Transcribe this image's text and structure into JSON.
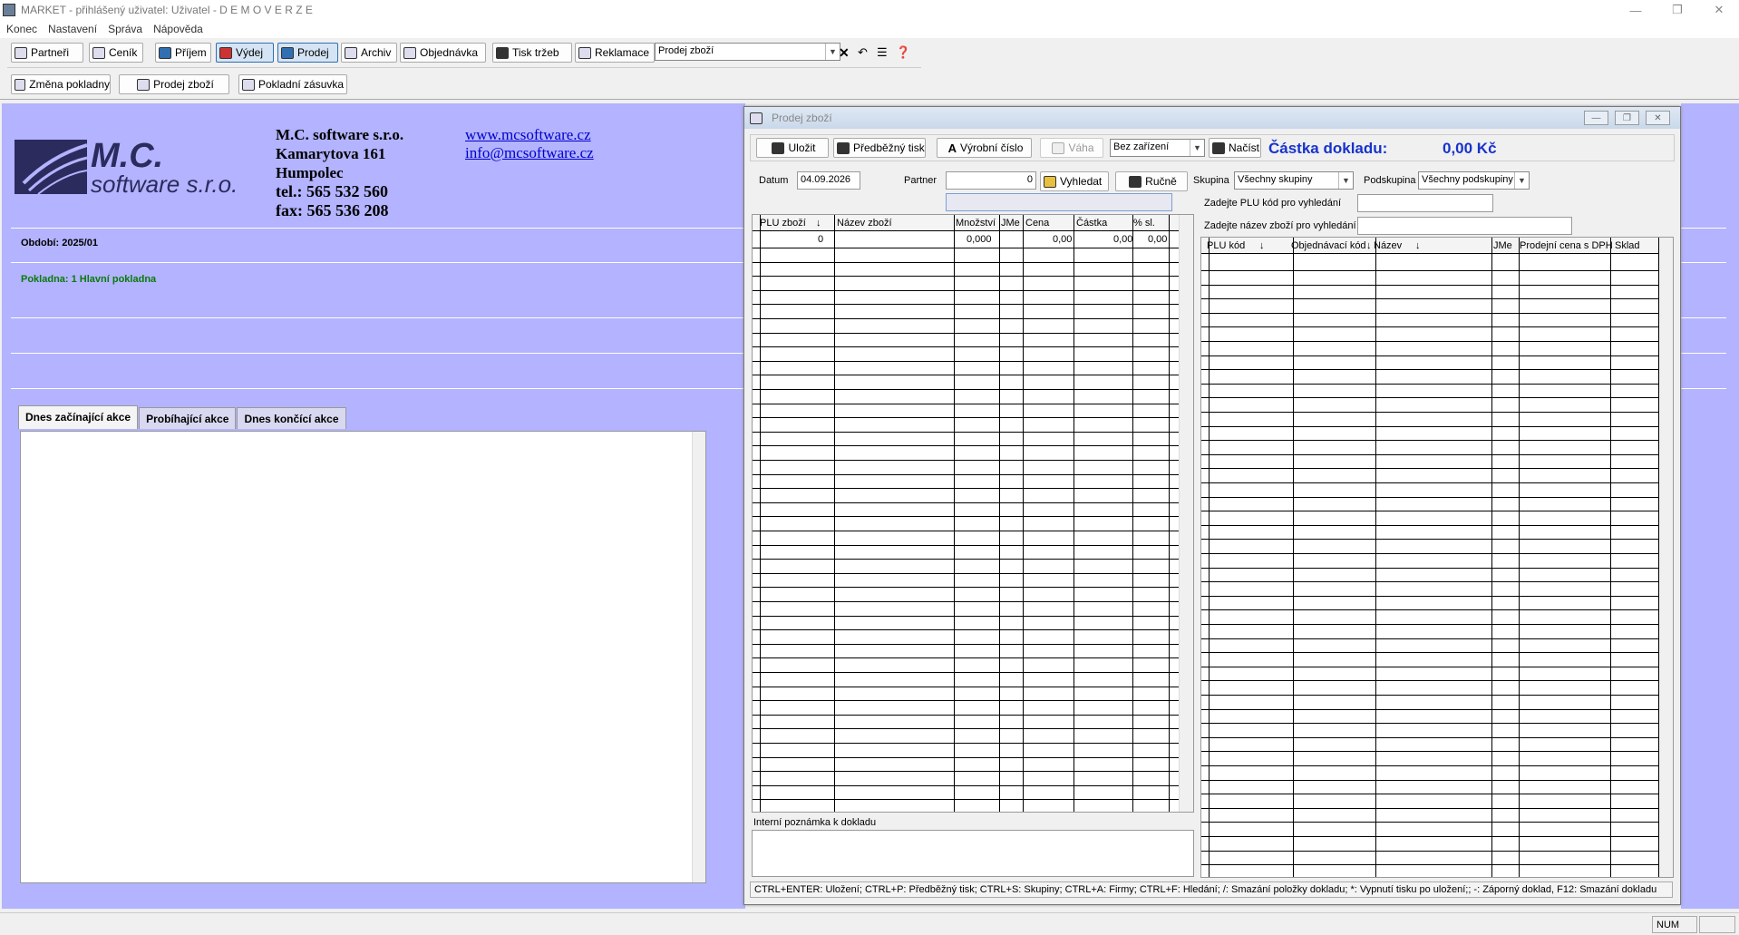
{
  "window": {
    "title": "MARKET - přihlášený uživatel: Uživatel - D E M O V E R Z E"
  },
  "menu": [
    "Konec",
    "Nastavení",
    "Správa",
    "Nápověda"
  ],
  "toolbar": {
    "partneri": "Partneři",
    "cenik": "Ceník",
    "prijem": "Příjem",
    "vydej": "Výdej",
    "prodej": "Prodej",
    "archiv": "Archiv",
    "objednavka": "Objednávka",
    "tisk_trzeb": "Tisk tržeb",
    "reklamace": "Reklamace",
    "module_select": "Prodej zboží"
  },
  "subtoolbar": {
    "zmena_pokladny": "Změna pokladny",
    "prodej_zbozi": "Prodej zboží",
    "pokladni_zasuvka": "Pokladní zásuvka"
  },
  "company": {
    "logo_line1": "M.C.",
    "logo_line2": "software s.r.o.",
    "name": "M.C. software s.r.o.",
    "street": "Kamarytova 161",
    "city": "Humpolec",
    "tel": "tel.: 565 532 560",
    "fax": "fax: 565 536 208",
    "web": "www.mcsoftware.cz",
    "email": "info@mcsoftware.cz"
  },
  "info": {
    "obdobi": "Období: 2025/01",
    "pokladna": "Pokladna: 1 Hlavní pokladna"
  },
  "tabs": [
    "Dnes začínající akce",
    "Probíhající akce",
    "Dnes končící akce"
  ],
  "dialog": {
    "title": "Prodej zboží",
    "buttons": {
      "ulozit": "Uložit",
      "predbezny_tisk": "Předběžný tisk",
      "vyrobni_cislo": "Výrobní číslo",
      "vaha": "Váha",
      "nacist": "Načíst",
      "vyhledat": "Vyhledat",
      "rucne": "Ručně"
    },
    "device_select": "Bez zařízení",
    "total_label": "Částka dokladu:",
    "total_value": "0,00 Kč",
    "datum_label": "Datum",
    "datum_value": "04.09.2026",
    "partner_label": "Partner",
    "partner_value": "0",
    "skupina_label": "Skupina",
    "skupina_value": "Všechny skupiny",
    "podskupina_label": "Podskupina",
    "podskupina_value": "Všechny podskupiny",
    "plu_search_label": "Zadejte PLU kód pro vyhledání",
    "name_search_label": "Zadejte název zboží pro vyhledání",
    "items_columns": [
      "PLU zboží",
      "↓",
      "Název zboží",
      "Množství",
      "JMe",
      "Cena",
      "Částka",
      "% sl."
    ],
    "items_first_row": [
      "0",
      "",
      "0,000",
      "",
      "0,00",
      "0,00",
      "0,00"
    ],
    "catalog_columns": [
      "PLU kód",
      "↓",
      "Objednávací kód",
      "↓",
      "Název",
      "↓",
      "JMe",
      "Prodejní cena s DPH",
      "↓",
      "Sklad"
    ],
    "note_label": "Interní poznámka k dokladu",
    "shortcuts": "CTRL+ENTER: Uložení;  CTRL+P: Předběžný tisk; CTRL+S: Skupiny; CTRL+A: Firmy; CTRL+F: Hledání; /: Smazání položky dokladu; *: Vypnutí tisku po uložení;; -: Záporný doklad, F12: Smazání dokladu"
  },
  "statusbar": {
    "num": "NUM"
  }
}
